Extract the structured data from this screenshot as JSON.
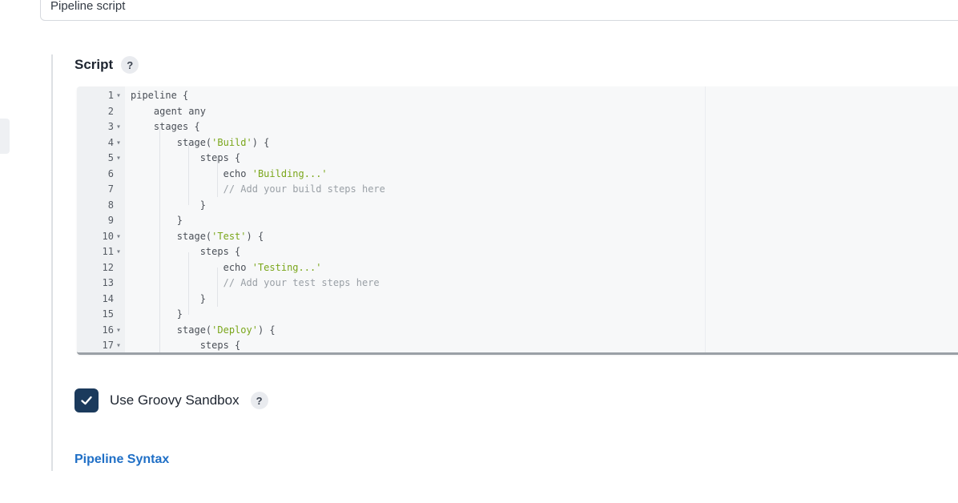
{
  "definition": {
    "selected_value": "Pipeline script"
  },
  "script": {
    "label": "Script",
    "help": "?",
    "lines": [
      {
        "n": "1",
        "fold": true,
        "parts": [
          {
            "t": "pipeline {",
            "c": ""
          }
        ]
      },
      {
        "n": "2",
        "fold": false,
        "parts": [
          {
            "t": "    agent any",
            "c": ""
          }
        ]
      },
      {
        "n": "3",
        "fold": true,
        "parts": [
          {
            "t": "    stages {",
            "c": ""
          }
        ]
      },
      {
        "n": "4",
        "fold": true,
        "parts": [
          {
            "t": "        stage(",
            "c": ""
          },
          {
            "t": "'Build'",
            "c": "str"
          },
          {
            "t": ") {",
            "c": ""
          }
        ]
      },
      {
        "n": "5",
        "fold": true,
        "parts": [
          {
            "t": "            steps {",
            "c": ""
          }
        ]
      },
      {
        "n": "6",
        "fold": false,
        "parts": [
          {
            "t": "                echo ",
            "c": ""
          },
          {
            "t": "'Building...'",
            "c": "str"
          }
        ]
      },
      {
        "n": "7",
        "fold": false,
        "parts": [
          {
            "t": "                // Add your build steps here",
            "c": "com"
          }
        ]
      },
      {
        "n": "8",
        "fold": false,
        "parts": [
          {
            "t": "            }",
            "c": ""
          }
        ]
      },
      {
        "n": "9",
        "fold": false,
        "parts": [
          {
            "t": "        }",
            "c": ""
          }
        ]
      },
      {
        "n": "10",
        "fold": true,
        "parts": [
          {
            "t": "        stage(",
            "c": ""
          },
          {
            "t": "'Test'",
            "c": "str"
          },
          {
            "t": ") {",
            "c": ""
          }
        ]
      },
      {
        "n": "11",
        "fold": true,
        "parts": [
          {
            "t": "            steps {",
            "c": ""
          }
        ]
      },
      {
        "n": "12",
        "fold": false,
        "parts": [
          {
            "t": "                echo ",
            "c": ""
          },
          {
            "t": "'Testing...'",
            "c": "str"
          }
        ]
      },
      {
        "n": "13",
        "fold": false,
        "parts": [
          {
            "t": "                // Add your test steps here",
            "c": "com"
          }
        ]
      },
      {
        "n": "14",
        "fold": false,
        "parts": [
          {
            "t": "            }",
            "c": ""
          }
        ]
      },
      {
        "n": "15",
        "fold": false,
        "parts": [
          {
            "t": "        }",
            "c": ""
          }
        ]
      },
      {
        "n": "16",
        "fold": true,
        "parts": [
          {
            "t": "        stage(",
            "c": ""
          },
          {
            "t": "'Deploy'",
            "c": "str"
          },
          {
            "t": ") {",
            "c": ""
          }
        ]
      },
      {
        "n": "17",
        "fold": true,
        "parts": [
          {
            "t": "            steps {",
            "c": ""
          }
        ]
      }
    ]
  },
  "sandbox": {
    "label": "Use Groovy Sandbox",
    "checked": true,
    "help": "?"
  },
  "links": {
    "pipeline_syntax": "Pipeline Syntax"
  },
  "colors": {
    "checkbox": "#1b3a5c",
    "link": "#1f6fc6",
    "string": "#7aa61a",
    "comment": "#9aa0a6"
  }
}
